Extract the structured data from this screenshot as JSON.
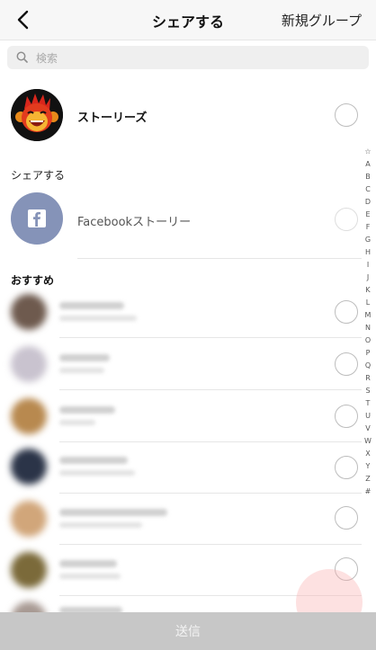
{
  "header": {
    "title": "シェアする",
    "new_group_label": "新規グループ"
  },
  "search": {
    "placeholder": "検索"
  },
  "stories": {
    "label": "ストーリーズ"
  },
  "share_section": {
    "title": "シェアする",
    "facebook_label": "Facebookストーリー"
  },
  "recommended": {
    "title": "おすすめ",
    "avatar_colors": [
      "#6e5a4e",
      "#c9c3cf",
      "#b8894f",
      "#2b3448",
      "#d1a67a",
      "#7b6a3a",
      "#a89a93"
    ]
  },
  "index_letters": [
    "☆",
    "A",
    "B",
    "C",
    "D",
    "E",
    "F",
    "G",
    "H",
    "I",
    "J",
    "K",
    "L",
    "M",
    "N",
    "O",
    "P",
    "Q",
    "R",
    "S",
    "T",
    "U",
    "V",
    "W",
    "X",
    "Y",
    "Z",
    "#"
  ],
  "send": {
    "label": "送信"
  },
  "colors": {
    "facebook_avatar": "#8593b8",
    "send_bar": "#c7c7c7"
  },
  "icons": {
    "back": "chevron-left-icon",
    "search": "search-icon",
    "facebook": "facebook-icon"
  }
}
